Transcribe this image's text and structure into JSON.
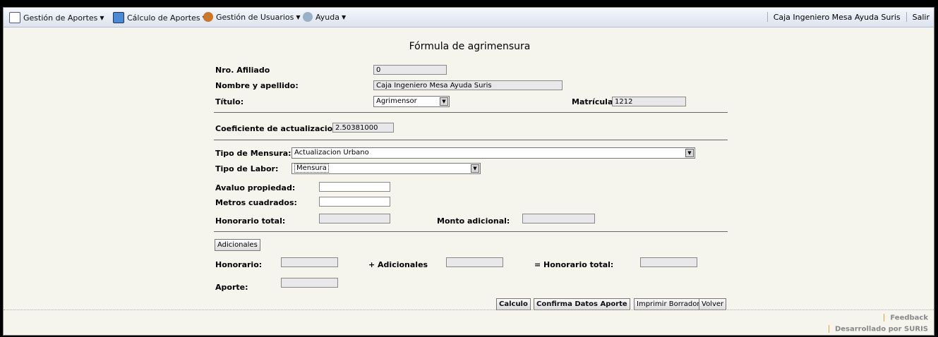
{
  "menu": {
    "items": [
      {
        "label": "Gestión de Aportes",
        "icon": "document-icon"
      },
      {
        "label": "Cálculo de Aportes",
        "icon": "calculator-icon"
      },
      {
        "label": "Gestión de Usuarios",
        "icon": "users-icon"
      },
      {
        "label": "Ayuda",
        "icon": "help-icon"
      }
    ],
    "user": "Caja Ingeniero Mesa Ayuda Suris",
    "logout": "Salir"
  },
  "form": {
    "title": "Fórmula de agrimensura",
    "nro_afiliado": {
      "label": "Nro. Afiliado",
      "value": "0"
    },
    "nombre": {
      "label": "Nombre y apellido:",
      "value": "Caja Ingeniero Mesa Ayuda Suris"
    },
    "titulo": {
      "label": "Título:",
      "value": "Agrimensor"
    },
    "matricula": {
      "label": "Matrícula",
      "value": "1212"
    },
    "coeficiente": {
      "label": "Coeficiente de actualizacion:",
      "value": "2.50381000"
    },
    "tipo_mensura": {
      "label": "Tipo de Mensura:",
      "value": "Actualizacion Urbano"
    },
    "tipo_labor": {
      "label": "Tipo de Labor:",
      "value": "Mensura"
    },
    "avaluo": {
      "label": "Avaluo propiedad:",
      "value": ""
    },
    "metros": {
      "label": "Metros cuadrados:",
      "value": ""
    },
    "honorario_total": {
      "label": "Honorario total:",
      "value": ""
    },
    "monto_adicional": {
      "label": "Monto adicional:",
      "value": ""
    },
    "adicionales_button": "Adicionales",
    "honorario": {
      "label": "Honorario:",
      "value": ""
    },
    "mas_adicionales": {
      "label": "+ Adicionales",
      "value": ""
    },
    "igual_honorario_total": {
      "label": "= Honorario total:",
      "value": ""
    },
    "aporte": {
      "label": "Aporte:",
      "value": ""
    }
  },
  "buttons": {
    "calculo": "Calculo",
    "confirma": "Confirma Datos Aporte",
    "imprimir": "Imprimir Borrador",
    "volver": "Volver"
  },
  "footer": {
    "feedback": "Feedback",
    "desarrollado": "Desarrollado por SURIS"
  },
  "colors": {
    "background": "#f5f5ee",
    "menubar": "#dde3ef"
  }
}
